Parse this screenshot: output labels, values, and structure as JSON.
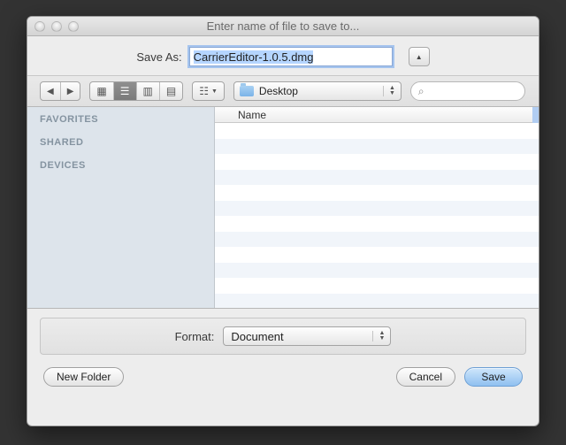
{
  "window": {
    "title": "Enter name of file to save to..."
  },
  "save": {
    "label": "Save As:",
    "filename": "CarrierEditor-1.0.5.dmg"
  },
  "location": {
    "name": "Desktop"
  },
  "search": {
    "placeholder": ""
  },
  "sidebar": {
    "sections": [
      "FAVORITES",
      "SHARED",
      "DEVICES"
    ]
  },
  "filelist": {
    "column_header": "Name",
    "rows": []
  },
  "format": {
    "label": "Format:",
    "value": "Document"
  },
  "buttons": {
    "new_folder": "New Folder",
    "cancel": "Cancel",
    "save": "Save"
  }
}
